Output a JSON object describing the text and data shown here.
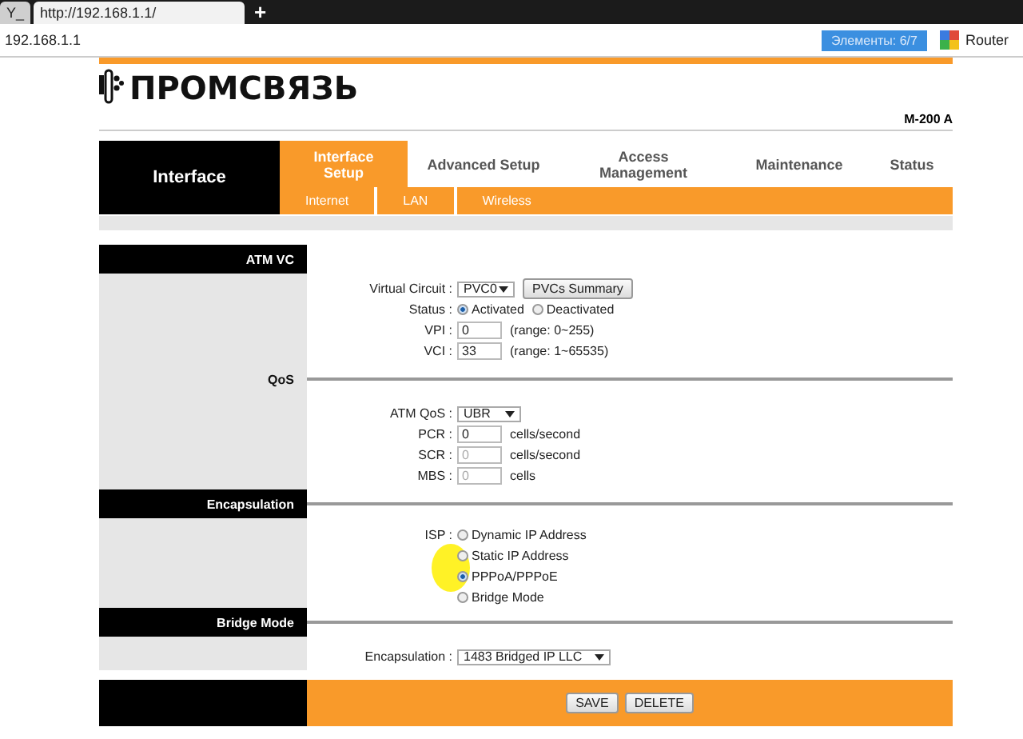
{
  "browser": {
    "tabs": [
      {
        "label": "Y_",
        "selected": false
      },
      {
        "label": "http://192.168.1.1/",
        "selected": true
      }
    ],
    "new_tab": "+",
    "address": "192.168.1.1",
    "find_count": "Элементы:  6/7",
    "search_engine": "Router"
  },
  "header": {
    "logo": "ПРОМСВЯЗЬ",
    "model": "M-200 A"
  },
  "nav": {
    "section": "Interface",
    "tabs": [
      {
        "label": "Interface Setup",
        "selected": true
      },
      {
        "label": "Advanced Setup",
        "selected": false
      },
      {
        "label": "Access Management",
        "selected": false
      },
      {
        "label": "Maintenance",
        "selected": false
      },
      {
        "label": "Status",
        "selected": false
      }
    ],
    "subtabs": [
      {
        "label": "Internet",
        "selected": false
      },
      {
        "label": "LAN",
        "selected": false
      },
      {
        "label": "Wireless",
        "selected": false
      }
    ]
  },
  "sections": [
    {
      "title": "ATM VC",
      "kind": "header",
      "rows": [
        {
          "kind": "select",
          "label": "Virtual Circuit :",
          "value": "PVC0",
          "button": "PVCs Summary"
        },
        {
          "kind": "radio-inline",
          "label": "Status :",
          "options": [
            {
              "label": "Activated",
              "selected": true
            },
            {
              "label": "Deactivated",
              "selected": false
            }
          ]
        },
        {
          "kind": "input",
          "label": "VPI :",
          "value": "0",
          "note": "(range: 0~255)",
          "disabled": false
        },
        {
          "kind": "input",
          "label": "VCI :",
          "value": "33",
          "note": "(range: 1~65535)",
          "disabled": false
        }
      ]
    },
    {
      "title": "QoS",
      "kind": "plain",
      "rows": [
        {
          "kind": "select",
          "label": "ATM QoS :",
          "value": "UBR"
        },
        {
          "kind": "input",
          "label": "PCR :",
          "value": "0",
          "note": "cells/second",
          "disabled": false
        },
        {
          "kind": "input",
          "label": "SCR :",
          "value": "0",
          "note": "cells/second",
          "disabled": true
        },
        {
          "kind": "input",
          "label": "MBS :",
          "value": "0",
          "note": "cells",
          "disabled": true
        }
      ]
    },
    {
      "title": "Encapsulation",
      "kind": "header",
      "rows": [
        {
          "kind": "radio-stack",
          "label": "ISP :",
          "options": [
            {
              "label": "Dynamic IP Address",
              "selected": false
            },
            {
              "label": "Static IP Address",
              "selected": false
            },
            {
              "label": "PPPoA/PPPoE",
              "selected": true
            },
            {
              "label": "Bridge Mode",
              "selected": false
            }
          ]
        }
      ]
    },
    {
      "title": "Bridge Mode",
      "kind": "header",
      "rows": [
        {
          "kind": "select",
          "label": "Encapsulation :",
          "value": "1483 Bridged IP LLC",
          "wide": true
        }
      ]
    }
  ],
  "buttons": [
    "SAVE",
    "DELETE"
  ]
}
